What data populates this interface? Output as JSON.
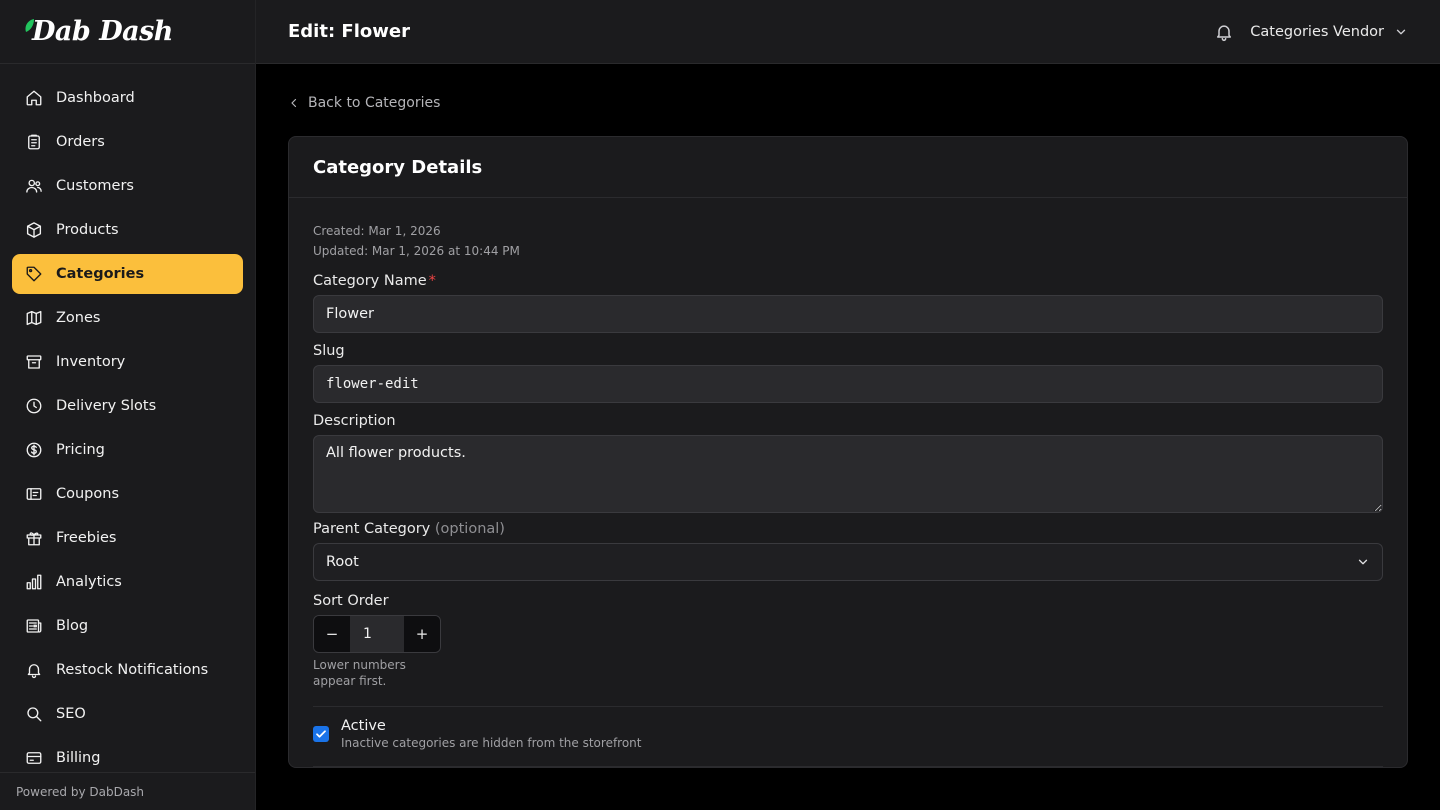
{
  "brand": {
    "name": "Dab Dash",
    "leaf_color": "#22c55e"
  },
  "sidebar": {
    "items": [
      {
        "label": "Dashboard",
        "icon": "home-icon"
      },
      {
        "label": "Orders",
        "icon": "clipboard-icon"
      },
      {
        "label": "Customers",
        "icon": "users-icon"
      },
      {
        "label": "Products",
        "icon": "box-icon"
      },
      {
        "label": "Categories",
        "icon": "tag-icon",
        "active": true
      },
      {
        "label": "Zones",
        "icon": "map-icon"
      },
      {
        "label": "Inventory",
        "icon": "archive-icon"
      },
      {
        "label": "Delivery Slots",
        "icon": "clock-icon"
      },
      {
        "label": "Pricing",
        "icon": "dollar-icon"
      },
      {
        "label": "Coupons",
        "icon": "coupon-icon"
      },
      {
        "label": "Freebies",
        "icon": "gift-icon"
      },
      {
        "label": "Analytics",
        "icon": "bar-chart-icon"
      },
      {
        "label": "Blog",
        "icon": "newspaper-icon"
      },
      {
        "label": "Restock Notifications",
        "icon": "bell-icon"
      },
      {
        "label": "SEO",
        "icon": "search-icon"
      },
      {
        "label": "Billing",
        "icon": "credit-card-icon"
      }
    ],
    "footer": "Powered by DabDash",
    "active_color": "#fbbf3c"
  },
  "header": {
    "title": "Edit: Flower",
    "vendor": "Categories Vendor"
  },
  "back_link": "Back to Categories",
  "card": {
    "title": "Category Details",
    "created": "Created: Mar 1, 2026",
    "updated": "Updated: Mar 1, 2026 at 10:44 PM"
  },
  "form": {
    "name_label": "Category Name",
    "name_required": "*",
    "name_value": "Flower",
    "slug_label": "Slug",
    "slug_value": "flower-edit",
    "description_label": "Description",
    "description_value": "All flower products.",
    "parent_label": "Parent Category",
    "parent_optional": "(optional)",
    "parent_value": "Root",
    "sort_label": "Sort Order",
    "sort_minus": "−",
    "sort_value": "1",
    "sort_plus": "+",
    "sort_hint": "Lower numbers appear first.",
    "active_label": "Active",
    "active_checked": true,
    "active_desc": "Inactive categories are hidden from the storefront",
    "checkbox_color": "#1a73e8"
  }
}
